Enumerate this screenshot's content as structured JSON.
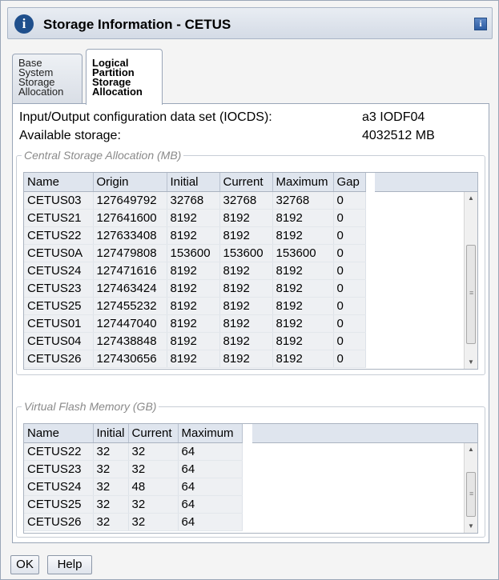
{
  "window": {
    "title": "Storage Information - CETUS",
    "info_icon": "info-icon",
    "help_icon_glyph": "i"
  },
  "tabs": [
    {
      "label_lines": [
        "Base",
        "System",
        "Storage",
        "Allocation"
      ],
      "active": false
    },
    {
      "label_lines": [
        "Logical",
        "Partition",
        "Storage",
        "Allocation"
      ],
      "active": true
    }
  ],
  "info": {
    "iocds_label": "Input/Output configuration data set (IOCDS):",
    "iocds_value": "a3 IODF04",
    "available_label": "Available storage:",
    "available_value": "4032512 MB"
  },
  "central": {
    "legend": "Central Storage Allocation (MB)",
    "columns": [
      "Name",
      "Origin",
      "Initial",
      "Current",
      "Maximum",
      "Gap"
    ],
    "rows": [
      [
        "CETUS03",
        "127649792",
        "32768",
        "32768",
        "32768",
        "0"
      ],
      [
        "CETUS21",
        "127641600",
        "8192",
        "8192",
        "8192",
        "0"
      ],
      [
        "CETUS22",
        "127633408",
        "8192",
        "8192",
        "8192",
        "0"
      ],
      [
        "CETUS0A",
        "127479808",
        "153600",
        "153600",
        "153600",
        "0"
      ],
      [
        "CETUS24",
        "127471616",
        "8192",
        "8192",
        "8192",
        "0"
      ],
      [
        "CETUS23",
        "127463424",
        "8192",
        "8192",
        "8192",
        "0"
      ],
      [
        "CETUS25",
        "127455232",
        "8192",
        "8192",
        "8192",
        "0"
      ],
      [
        "CETUS01",
        "127447040",
        "8192",
        "8192",
        "8192",
        "0"
      ],
      [
        "CETUS04",
        "127438848",
        "8192",
        "8192",
        "8192",
        "0"
      ],
      [
        "CETUS26",
        "127430656",
        "8192",
        "8192",
        "8192",
        "0"
      ]
    ]
  },
  "flash": {
    "legend": "Virtual Flash Memory (GB)",
    "columns": [
      "Name",
      "Initial",
      "Current",
      "Maximum"
    ],
    "rows": [
      [
        "CETUS22",
        "32",
        "32",
        "64"
      ],
      [
        "CETUS23",
        "32",
        "32",
        "64"
      ],
      [
        "CETUS24",
        "32",
        "48",
        "64"
      ],
      [
        "CETUS25",
        "32",
        "32",
        "64"
      ],
      [
        "CETUS26",
        "32",
        "32",
        "64"
      ]
    ]
  },
  "buttons": {
    "ok": "OK",
    "help": "Help"
  },
  "colors": {
    "header_bg": "#dfe5ee",
    "row_bg": "#eef0f3",
    "accent": "#1f4f8c"
  }
}
